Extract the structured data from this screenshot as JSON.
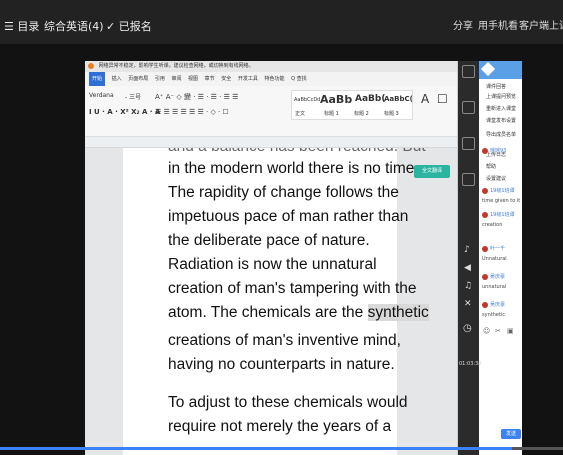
{
  "topbar": {
    "catalog": "☰ 目录",
    "course": "综合英语(4)",
    "signed": "✓ 已报名",
    "share": "分享",
    "mobile": "用手机看",
    "client": "客户端上课"
  },
  "doc_window": {
    "notice": "网络异常不稳定，影响学生听课，建议检查网络，或切换到有线网络。",
    "menus": [
      "开始",
      "插入",
      "页面布局",
      "引用",
      "审阅",
      "视图",
      "章节",
      "安全",
      "开发工具",
      "特色功能",
      "Q 查找"
    ],
    "ribbon_font": "Verdana",
    "ribbon_size": "- 三号",
    "styles": [
      "AaBbCcDd",
      "AaBb",
      "AaBb(",
      "AaBbC("
    ],
    "style_labels": [
      "正文",
      "标题 1",
      "标题 2",
      "标题 3"
    ]
  },
  "document": {
    "lines": [
      {
        "text": "and a balance has been reached. But",
        "highlight": ""
      },
      {
        "text": "in the modern world there is no time.",
        "highlight": ""
      },
      {
        "text": "The rapidity of change follows the",
        "highlight": ""
      },
      {
        "text": "impetuous pace of man rather than",
        "highlight": ""
      },
      {
        "text": "the deliberate pace of nature.",
        "highlight": ""
      },
      {
        "text": "Radiation is now the unnatural",
        "highlight": ""
      },
      {
        "text": "creation of man's tampering with the",
        "highlight": ""
      },
      {
        "text": "atom. The chemicals are the ",
        "highlight": "synthetic"
      },
      {
        "text": "creations of man's inventive mind,",
        "highlight": ""
      },
      {
        "text": "having no counterparts in nature.",
        "highlight": ""
      },
      {
        "text": "",
        "highlight": ""
      },
      {
        "text": "To adjust to these chemicals would",
        "highlight": ""
      },
      {
        "text": "require not merely the years of a",
        "highlight": ""
      }
    ],
    "translate_button": "全文翻译"
  },
  "chat": {
    "menu": [
      "课件回答",
      "上课提问预览",
      "重新进入课堂",
      "课堂发布设置",
      "导出成员名单",
      "上传日志",
      "帮助",
      "设置建议"
    ],
    "messages": [
      {
        "name": "瑶瑶93",
        "text": "no"
      },
      {
        "name": "19级1班谭",
        "text": "time given to it"
      },
      {
        "name": "19级1班谭",
        "text": "creation"
      },
      {
        "name": "叶一千",
        "text": "Unnatural"
      },
      {
        "name": "吴庆豪",
        "text": "unnatural"
      },
      {
        "name": "吴庆豪",
        "text": "synthetic"
      }
    ],
    "send": "发送",
    "time": "01:03:38"
  },
  "progress": {
    "value": 0.91
  },
  "colors": {
    "accent": "#3b82f6",
    "chat_head": "#5aa0e6",
    "highlight": "#d9d9d9"
  }
}
